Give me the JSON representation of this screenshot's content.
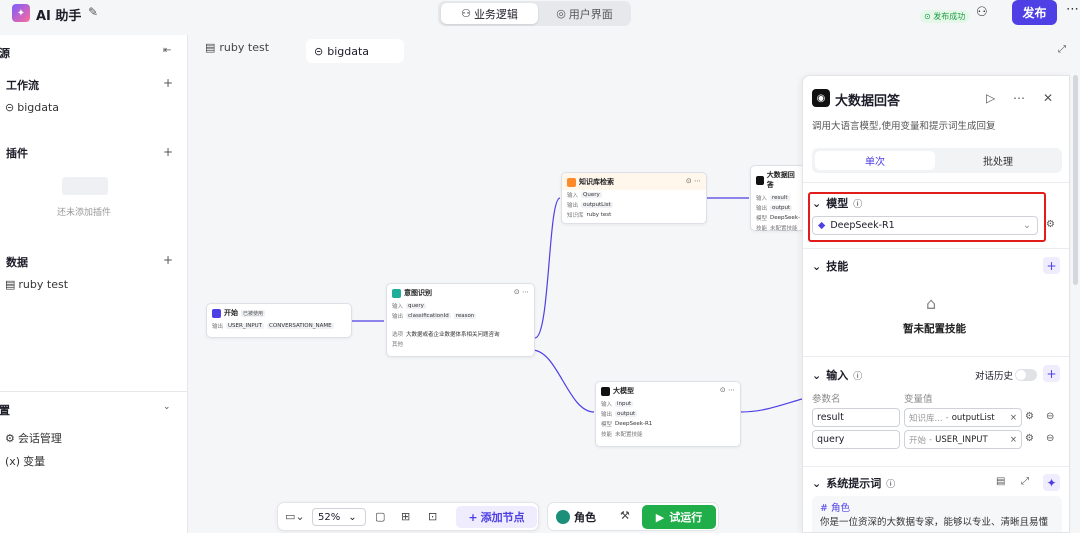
{
  "app": {
    "title": "AI 助手"
  },
  "top": {
    "seg_active": "业务逻辑",
    "seg_other": "用户界面",
    "publish_ok": "发布成功",
    "publish": "发布"
  },
  "left": {
    "section_resources": "资源",
    "workflow": "工作流",
    "workflow_items": [
      "bigdata"
    ],
    "plugins": "插件",
    "plugins_empty": "还未添加插件",
    "data": "数据",
    "data_items": [
      "ruby test"
    ],
    "settings": "设置",
    "settings_items": [
      "会话管理",
      "变量"
    ]
  },
  "tabs": [
    "ruby test",
    "bigdata"
  ],
  "nodes": {
    "start": {
      "title": "开始",
      "badge": "已被使用",
      "label_out": "输出",
      "out1": "USER_INPUT",
      "out2": "CONVERSATION_NAME"
    },
    "intent": {
      "title": "意图识别",
      "label_in": "输入",
      "in": "query",
      "label_out": "输出",
      "out1": "classificationId",
      "out2": "reason",
      "label_opt": "选项",
      "opt": "大数据或者企业数据体系相关问题咨询",
      "label_other": "其他"
    },
    "kb": {
      "title": "知识库检索",
      "label_in": "输入",
      "in": "Query",
      "label_out": "输出",
      "out": "outputList",
      "label_kb": "知识库",
      "kb": "ruby test"
    },
    "bigans": {
      "title": "大数据回答",
      "label_in": "输入",
      "in": "result",
      "label_out": "输出",
      "out": "output",
      "label_model": "模型",
      "model": "DeepSeek-",
      "label_skill": "技能",
      "skill": "未配置技能"
    },
    "llm": {
      "title": "大模型",
      "label_in": "输入",
      "in": "input",
      "label_out": "输出",
      "out": "output",
      "label_model": "模型",
      "model": "DeepSeek-R1",
      "label_skill": "技能",
      "skill": "未配置技能"
    }
  },
  "toolbar": {
    "zoom": "52%",
    "add_node": "添加节点",
    "role": "角色",
    "run": "试运行"
  },
  "panel": {
    "title": "大数据回答",
    "desc": "调用大语言模型,使用变量和提示词生成回复",
    "mode_single": "单次",
    "mode_batch": "批处理",
    "model_label": "模型",
    "model_value": "DeepSeek-R1",
    "skills_label": "技能",
    "skills_empty": "暂未配置技能",
    "input_label": "输入",
    "history_label": "对话历史",
    "col_param": "参数名",
    "col_value": "变量值",
    "params": [
      {
        "name": "result",
        "src": "知识库...",
        "var": "outputList"
      },
      {
        "name": "query",
        "src": "开始",
        "var": "USER_INPUT"
      }
    ],
    "sys_prompt_label": "系统提示词",
    "prompt_line1": "# 角色",
    "prompt_line2": "你是一位资深的大数据专家，能够以专业、清晰且易懂"
  },
  "colors": {
    "accent": "#4e40e5",
    "run": "#1fae4a",
    "highlight": "#e21b1b"
  }
}
